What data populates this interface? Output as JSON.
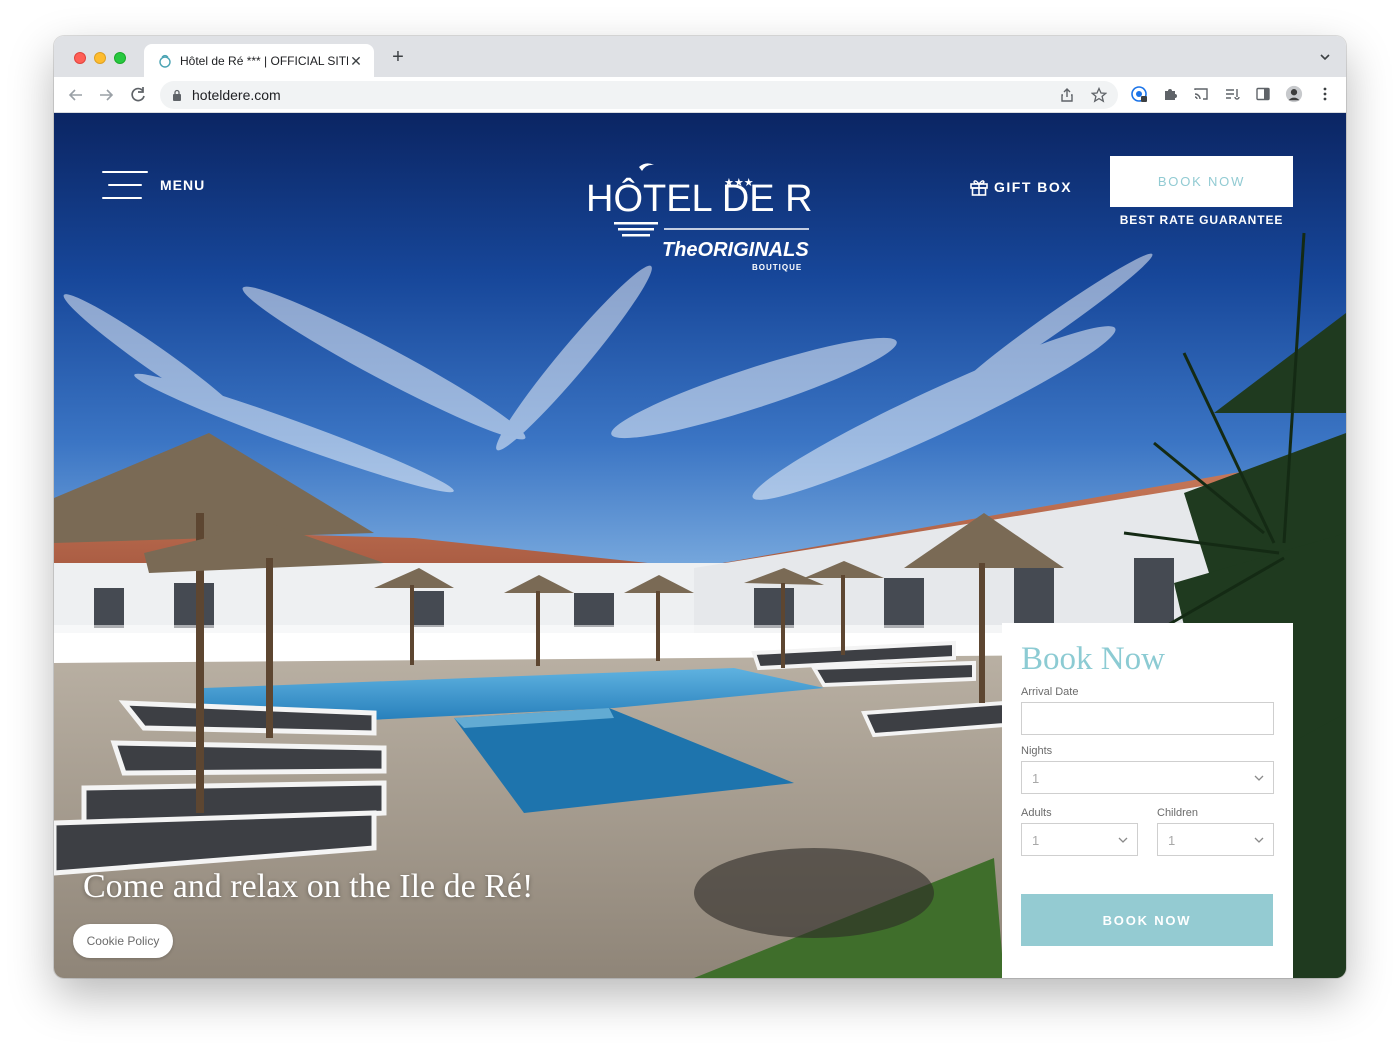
{
  "browser": {
    "tab_title": "Hôtel de Ré *** | OFFICIAL SITE",
    "url": "hoteldere.com",
    "new_tab_label": "+",
    "close_label": "✕"
  },
  "site": {
    "menu_label": "MENU",
    "logo": {
      "name": "HÔTEL DE RÉ",
      "stars": "★★★",
      "brand": "TheORIGINALS",
      "sub": "BOUTIQUE"
    },
    "gift_box_label": "GIFT BOX",
    "book_now_top": "BOOK NOW",
    "best_rate": "BEST RATE GUARANTEE",
    "tagline": "Come and relax on the Ile de Ré!",
    "cookie_label": "Cookie Policy",
    "booking": {
      "title": "Book Now",
      "arrival_label": "Arrival Date",
      "arrival_value": "",
      "nights_label": "Nights",
      "nights_value": "1",
      "adults_label": "Adults",
      "adults_value": "1",
      "children_label": "Children",
      "children_value": "1",
      "submit_label": "BOOK NOW"
    }
  },
  "colors": {
    "accent": "#94cbd2",
    "sky_top": "#0c2a66",
    "sky_bottom": "#5a8fd0"
  }
}
